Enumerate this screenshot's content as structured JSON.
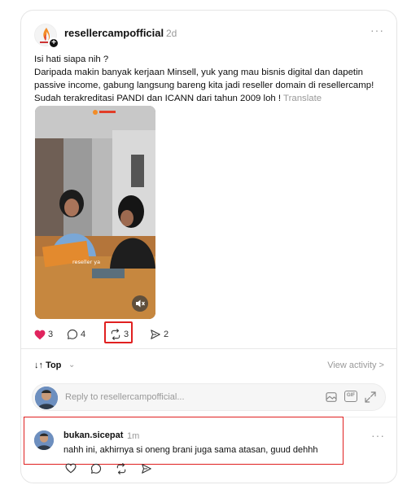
{
  "post": {
    "username": "resellercampofficial",
    "time": "2d",
    "more": "···",
    "text_line1": "Isi hati siapa nih ?",
    "text_body": "Daripada makin banyak kerjaan Minsell, yuk yang mau bisnis digital dan dapetin passive income, gabung langsung bareng kita jadi reseller domain di resellercamp! Sudah terakreditasi PANDI dan ICANN dari tahun 2009 loh ! ",
    "translate": "Translate",
    "media_caption": "reseller ya"
  },
  "actions": {
    "likes": "3",
    "comments": "4",
    "reposts": "3",
    "shares": "2"
  },
  "sort": {
    "label": "Top",
    "view_activity": "View activity >"
  },
  "reply": {
    "placeholder": "Reply to resellercampofficial...",
    "gif": "GIF"
  },
  "comment": {
    "username": "bukan.sicepat",
    "time": "1m",
    "text": "nahh ini, akhirnya si oneng brani juga sama atasan, guud dehhh",
    "more": "···"
  },
  "colors": {
    "like": "#e0245e",
    "highlight": "#e02020"
  }
}
